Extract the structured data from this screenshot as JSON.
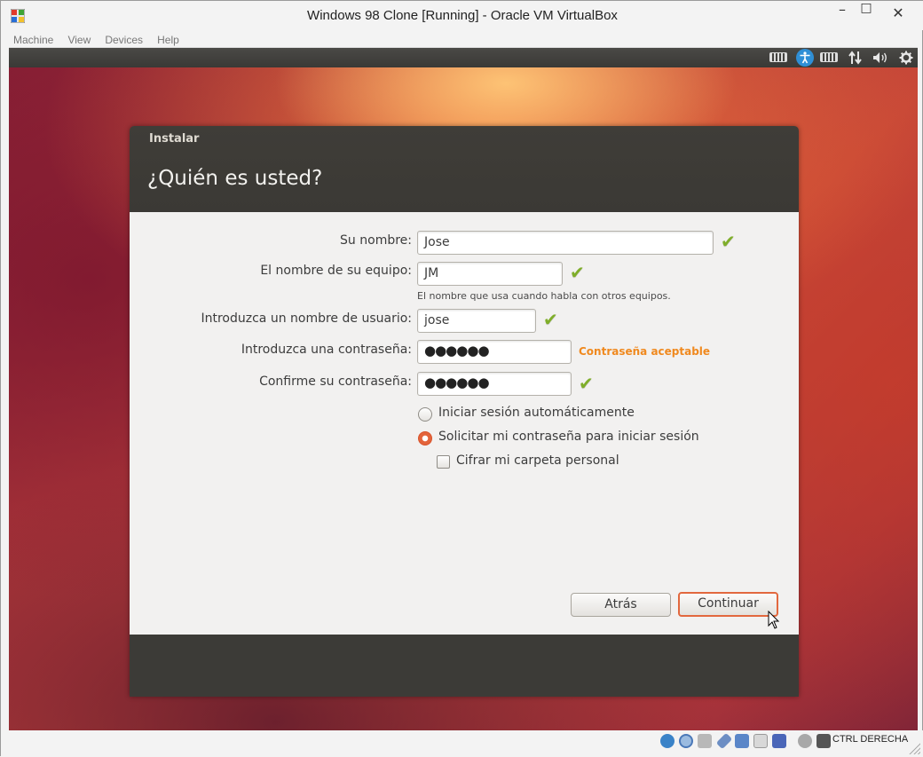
{
  "window": {
    "title": "Windows 98 Clone [Running] - Oracle VM VirtualBox",
    "controls": {
      "minimize": "–",
      "maximize": "□",
      "close": "✕"
    }
  },
  "menu": [
    "Machine",
    "View",
    "Devices",
    "Help"
  ],
  "vm_topbar_icons": [
    "keyboard-icon",
    "accessibility-icon",
    "keyboard-layout-icon",
    "network-icon",
    "volume-icon",
    "settings-gear-icon"
  ],
  "dialog": {
    "app_name": "Instalar",
    "heading": "¿Quién es usted?",
    "fields": {
      "name_label": "Su nombre:",
      "name_value": "Jose",
      "computer_label": "El nombre de su equipo:",
      "computer_value": "JM",
      "computer_hint": "El nombre que usa cuando habla con otros equipos.",
      "username_label": "Introduzca un nombre de usuario:",
      "username_value": "jose",
      "password_label": "Introduzca una contraseña:",
      "password_value": "●●●●●●",
      "password_strength": "Contraseña aceptable",
      "confirm_label": "Confirme su contraseña:",
      "confirm_value": "●●●●●●"
    },
    "options": {
      "autologin": "Iniciar sesión automáticamente",
      "require_password": "Solicitar mi contraseña para iniciar sesión",
      "encrypt_home": "Cifrar mi carpeta personal"
    },
    "buttons": {
      "back": "Atrás",
      "continue": "Continuar"
    }
  },
  "statusbar": {
    "host_key": "CTRL DERECHA",
    "icons": [
      "hard-disk-icon",
      "optical-drive-icon",
      "floppy-icon",
      "usb-icon",
      "shared-folders-icon",
      "display-icon",
      "video-capture-icon",
      "network-adapter-icon",
      "mouse-integration-icon",
      "host-key-icon"
    ]
  }
}
